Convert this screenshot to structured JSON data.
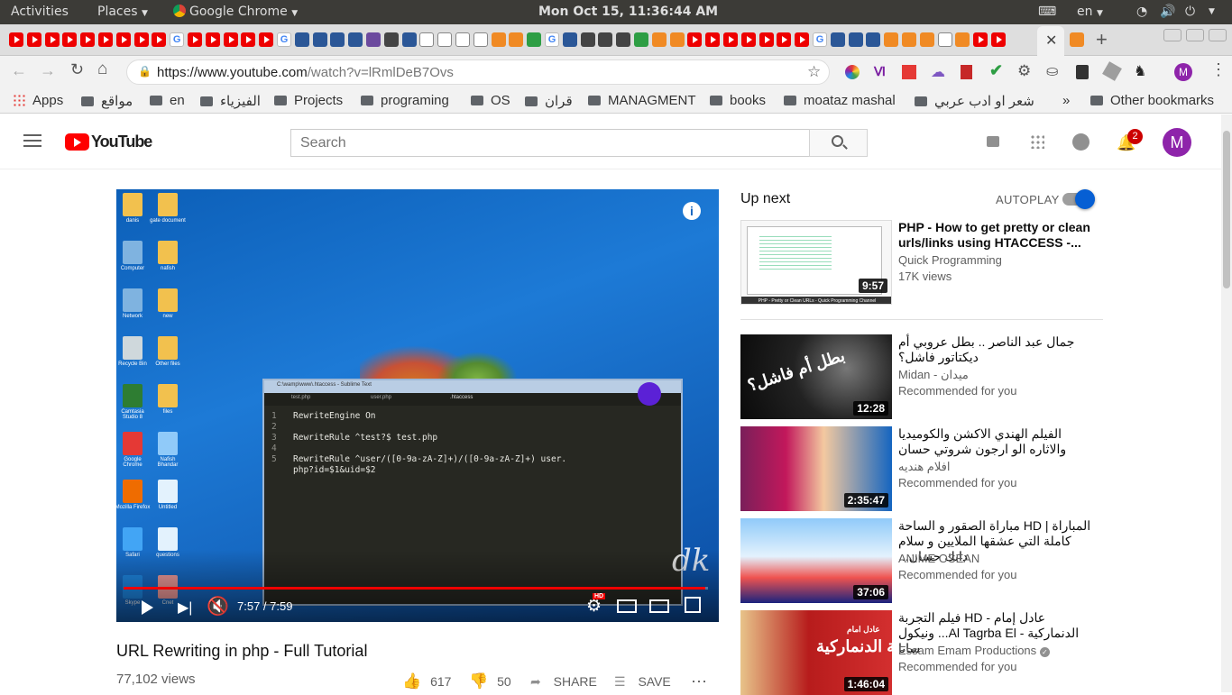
{
  "topbar": {
    "activities": "Activities",
    "places": "Places",
    "app": "Google Chrome",
    "clock": "Mon Oct 15, 11:36:44 AM",
    "lang": "en"
  },
  "address": {
    "url_host": "https://www.youtube.com",
    "url_path": "/watch?v=lRmlDeB7Ovs"
  },
  "bookmarks": {
    "apps": "Apps",
    "items": [
      "مواقع",
      "en",
      "الفيزياء",
      "Projects",
      "programing",
      "OS",
      "قران",
      "MANAGMENT",
      "books",
      "moataz mashal",
      "شعر او ادب عربي"
    ],
    "overflow": "»",
    "other": "Other bookmarks"
  },
  "youtube": {
    "logo": "YouTube",
    "search_placeholder": "Search",
    "notification_count": "2",
    "avatar_letter": "M"
  },
  "player": {
    "time": "7:57 / 7:59",
    "progress": 0.996,
    "watermark": "dk",
    "editor_title": "C:\\wamp\\www\\.htaccess - Sublime Text",
    "editor_tabs": [
      "test.php",
      "user.php",
      ".htaccess"
    ],
    "code_lines": [
      {
        "n": "1",
        "text": "RewriteEngine On"
      },
      {
        "n": "2",
        "text": ""
      },
      {
        "n": "3",
        "text": "RewriteRule ^test?$ test.php"
      },
      {
        "n": "4",
        "text": ""
      },
      {
        "n": "5",
        "text": "RewriteRule ^user/([0-9a-zA-Z]+)/([0-9a-zA-Z]+) user."
      },
      {
        "n": "",
        "text": "php?id=$1&uid=$2"
      }
    ],
    "desktop_icons": [
      "danis",
      "gate document",
      "Computer",
      "nafish",
      "Network",
      "new",
      "Recycle Bin",
      "Other files",
      "Camtasia Studio 8",
      "files",
      "Google Chrome",
      "Nafish Bhandar",
      "Mozilla Firefox",
      "Untitled",
      "Safari",
      "questions",
      "Skype",
      "Cnet"
    ]
  },
  "video": {
    "title": "URL Rewriting in php - Full Tutorial",
    "views": "77,102 views",
    "likes": "617",
    "dislikes": "50",
    "share": "SHARE",
    "save": "SAVE"
  },
  "sidebar": {
    "up_next": "Up next",
    "autoplay": "AUTOPLAY",
    "autoplay_on": true,
    "videos": [
      {
        "title": "PHP - How to get pretty or clean urls/links using HTACCESS -...",
        "channel": "Quick Programming",
        "meta": "17K views",
        "duration": "9:57",
        "thumb_caption": "PHP - Pretty or Clean URLs - Quick Programming Channel"
      },
      {
        "title": "جمال عبد الناصر .. بطل عروبي أم ديكتاتور فاشل؟",
        "channel": "Midan - ميدان",
        "meta": "Recommended for you",
        "duration": "12:28",
        "thumb_caption": "بطل أم فاشل؟"
      },
      {
        "title": "الفيلم الهندي الاكشن والكوميديا والاثاره الو ارجون شروتي حسان",
        "channel": "افلام هنديه",
        "meta": "Recommended for you",
        "duration": "2:35:47",
        "thumb_caption": ""
      },
      {
        "title": "المباراة | HD مباراة الصقور و الساحة كاملة التي عشقها الملايين و سلام دانك حسان...",
        "channel": "ANIME OSEAN",
        "meta": "Recommended for you",
        "duration": "37:06",
        "thumb_caption": ""
      },
      {
        "title": "عادل إمام - HD فيلم التجربة الدنماركية - Al Tagrba El... ونيكول سابا",
        "channel": "Essam Emam Productions",
        "meta": "Recommended for you",
        "duration": "1:46:04",
        "thumb_caption": "التجربة الدنماركية",
        "thumb_sub": "عادل امام",
        "verified": true
      }
    ]
  },
  "colors": {
    "yt_red": "#ff0000",
    "autoplay_blue": "#065fd4",
    "avatar_purple": "#8e24aa",
    "topbar": "#3c3b37"
  }
}
